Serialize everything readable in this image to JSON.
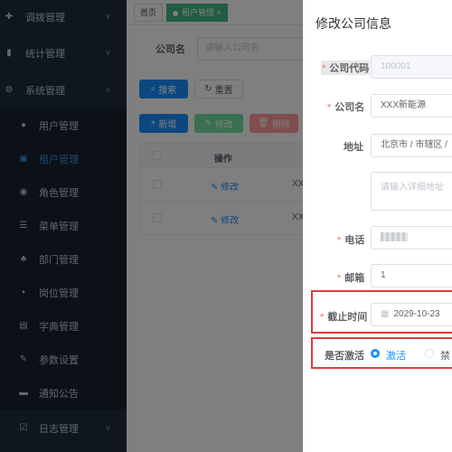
{
  "sidebar": {
    "items": [
      {
        "icon": "dispatch-icon",
        "label": "调拨管理"
      },
      {
        "icon": "stats-icon",
        "label": "统计管理"
      },
      {
        "icon": "gear-icon",
        "label": "系统管理"
      }
    ],
    "sub_items": [
      {
        "icon": "user-icon",
        "label": "用户管理"
      },
      {
        "icon": "tenant-icon",
        "label": "租户管理"
      },
      {
        "icon": "role-icon",
        "label": "角色管理"
      },
      {
        "icon": "menu-list-icon",
        "label": "菜单管理"
      },
      {
        "icon": "org-tree-icon",
        "label": "部门管理"
      },
      {
        "icon": "post-icon",
        "label": "岗位管理"
      },
      {
        "icon": "dict-icon",
        "label": "字典管理"
      },
      {
        "icon": "edit-icon",
        "label": "参数设置"
      },
      {
        "icon": "message-icon",
        "label": "通知公告"
      }
    ],
    "log_item": {
      "icon": "log-icon",
      "label": "日志管理"
    }
  },
  "tags": {
    "home": "首页",
    "active": "租户管理"
  },
  "search": {
    "label": "公司名",
    "placeholder": "请输入公司名"
  },
  "buttons": {
    "search": "搜索",
    "reset": "重置",
    "add": "新增",
    "edit": "修改",
    "delete": "删除"
  },
  "table": {
    "header_op": "操作",
    "rows": [
      {
        "edit": "修改",
        "name": "XX"
      },
      {
        "edit": "修改",
        "name": "XX"
      }
    ]
  },
  "dialog": {
    "title": "修改公司信息",
    "fields": {
      "code_label": "公司代码",
      "code_value": "100001",
      "name_label": "公司名",
      "name_value": "XXX新能源",
      "address_label": "地址",
      "address_value": "北京市 / 市辖区 /",
      "address_detail_placeholder": "请输入详细地址",
      "phone_label": "电话",
      "email_label": "邮箱",
      "email_value": "1",
      "deadline_label": "截止时间",
      "deadline_value": "2029-10-23",
      "active_label": "是否激活",
      "active_option_yes": "激活",
      "active_option_no": "禁"
    }
  },
  "colors": {
    "primary": "#1890ff",
    "highlight": "#e03a3a",
    "sidebar": "#1f2d3d"
  }
}
